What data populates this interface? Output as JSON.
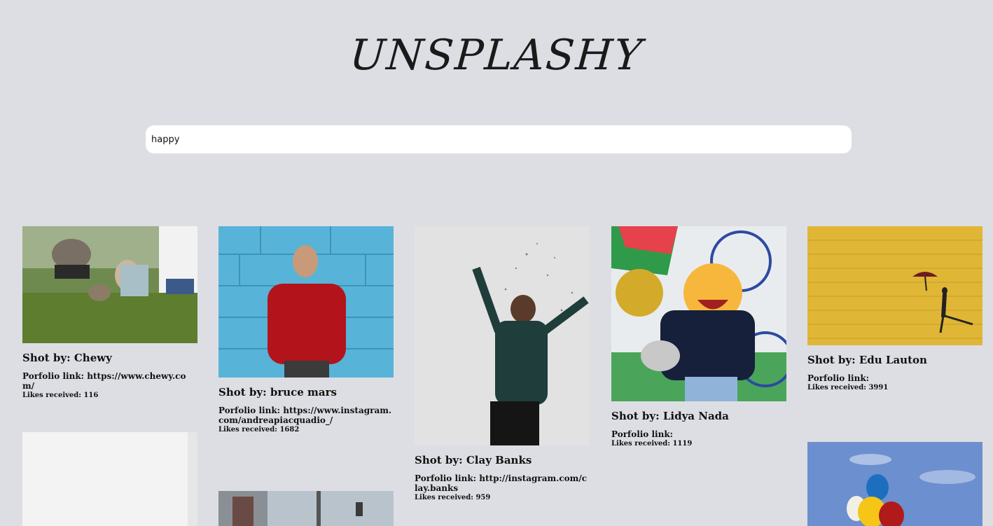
{
  "app": {
    "title": "UNSPLASHY"
  },
  "search": {
    "value": "happy"
  },
  "photos": [
    {
      "shot_by": "Shot by: Chewy",
      "portfolio": "Porfolio link: https://www.chewy.com/",
      "likes": "Likes received: 116",
      "subject": "family with dog on grass"
    },
    {
      "shot_by": "Shot by: bruce mars",
      "portfolio": "Porfolio link: https://www.instagram.com/andreapiacquadio_/",
      "likes": "Likes received: 1682",
      "subject": "man in red sweater against blue wall"
    },
    {
      "shot_by": "Shot by: Clay Banks",
      "portfolio": "Porfolio link: http://instagram.com/clay.banks",
      "likes": "Likes received: 959",
      "subject": "woman celebrating with confetti"
    },
    {
      "shot_by": "Shot by: Lidya Nada",
      "portfolio": "Porfolio link:",
      "likes": "Likes received: 1119",
      "subject": "person holding emoji balloon"
    },
    {
      "shot_by": "Shot by: Edu Lauton",
      "portfolio": "Porfolio link:",
      "likes": "Likes received: 3991",
      "subject": "person with umbrella on yellow wall"
    }
  ],
  "partial_photos": [
    {
      "subject": "white wall"
    },
    {
      "subject": "street scene"
    },
    {
      "subject": "colorful balloons in sky"
    }
  ]
}
